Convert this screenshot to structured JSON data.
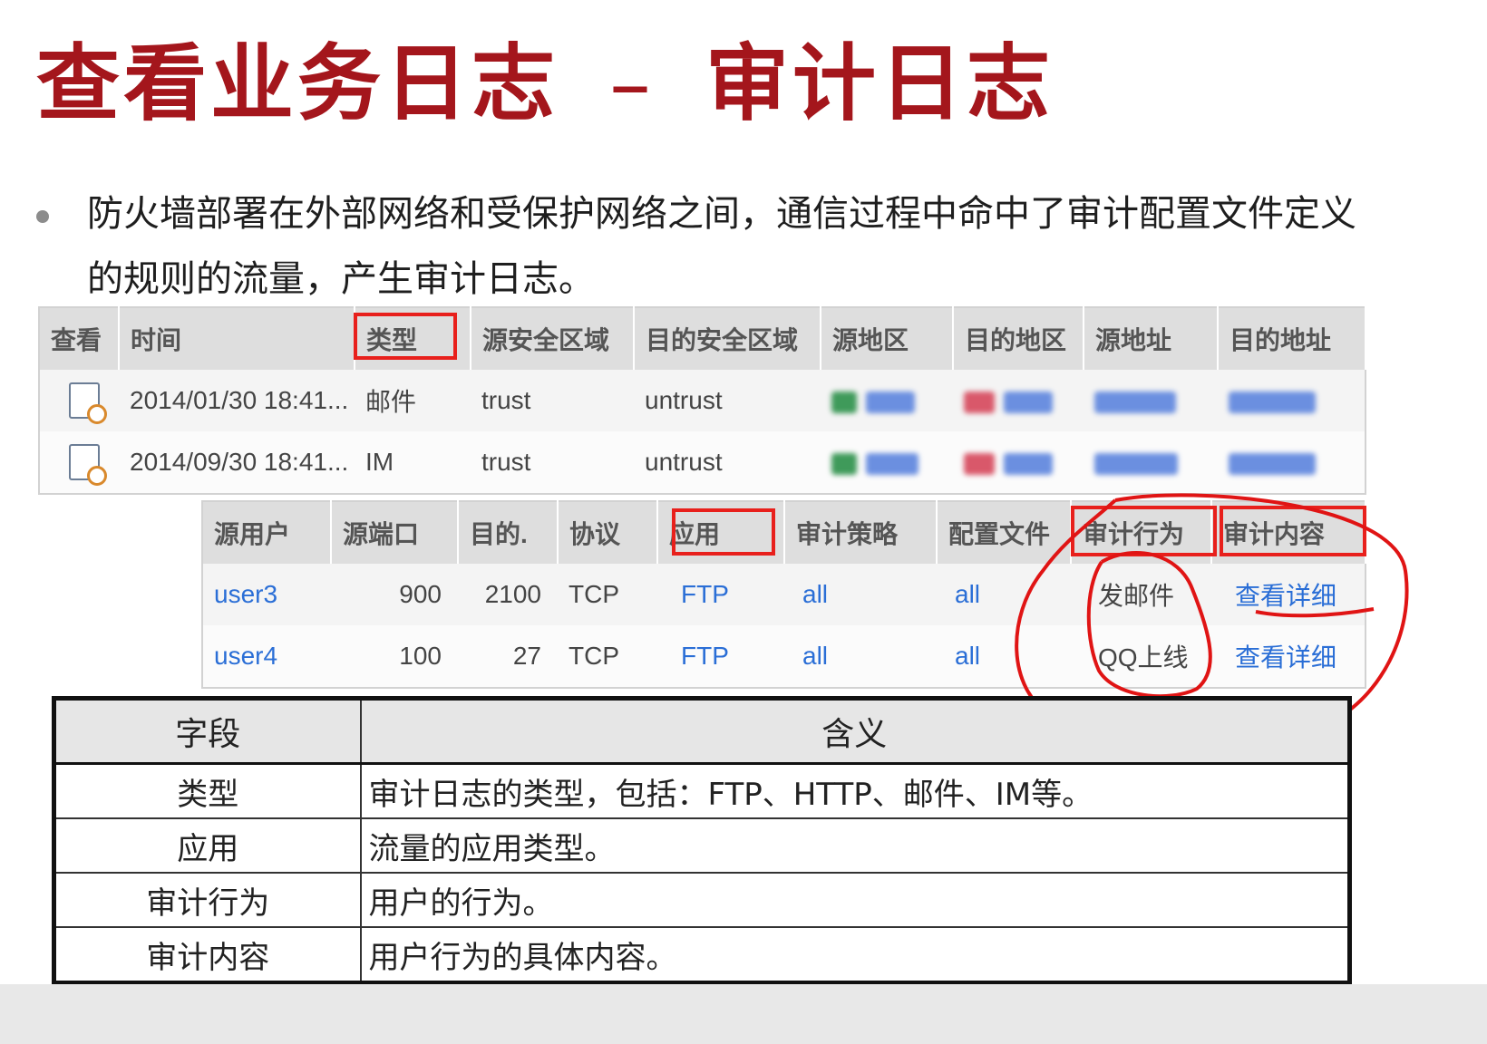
{
  "slide": {
    "title_left": "查看业务日志",
    "title_separator": "–",
    "title_right": "审计日志",
    "bullet_text": "防火墙部署在外部网络和受保护网络之间，通信过程中命中了审计配置文件定义的规则的流量，产生审计日志。"
  },
  "log_table_1": {
    "columns": [
      "查看",
      "时间",
      "类型",
      "源安全区域",
      "目的安全区域",
      "源地区",
      "目的地区",
      "源地址",
      "目的地址"
    ],
    "rows": [
      {
        "time": "2014/01/30 18:41...",
        "type": "邮件",
        "src_zone": "trust",
        "dst_zone": "untrust",
        "view_icon": "document-search-icon"
      },
      {
        "time": "2014/09/30 18:41...",
        "type": "IM",
        "src_zone": "trust",
        "dst_zone": "untrust",
        "view_icon": "document-search-icon"
      }
    ]
  },
  "log_table_2": {
    "columns": [
      "源用户",
      "源端口",
      "目的.",
      "协议",
      "应用",
      "审计策略",
      "配置文件",
      "审计行为",
      "审计内容"
    ],
    "rows": [
      {
        "user": "user3",
        "src_port": "900",
        "dst_port": "2100",
        "protocol": "TCP",
        "app": "FTP",
        "policy": "all",
        "profile": "all",
        "action": "发邮件",
        "content": "查看详细"
      },
      {
        "user": "user4",
        "src_port": "100",
        "dst_port": "27",
        "protocol": "TCP",
        "app": "FTP",
        "policy": "all",
        "profile": "all",
        "action": "QQ上线",
        "content": "查看详细"
      }
    ]
  },
  "definition_table": {
    "header": {
      "field": "字段",
      "meaning": "含义"
    },
    "rows": [
      {
        "field": "类型",
        "meaning": "审计日志的类型，包括：FTP、HTTP、邮件、IM等。"
      },
      {
        "field": "应用",
        "meaning": "流量的应用类型。"
      },
      {
        "field": "审计行为",
        "meaning": "用户的行为。"
      },
      {
        "field": "审计内容",
        "meaning": "用户行为的具体内容。"
      }
    ]
  },
  "colors": {
    "title": "#a4161c",
    "highlight_box": "#e8201c",
    "link": "#2a6ed6",
    "header_bg": "#dedede"
  }
}
